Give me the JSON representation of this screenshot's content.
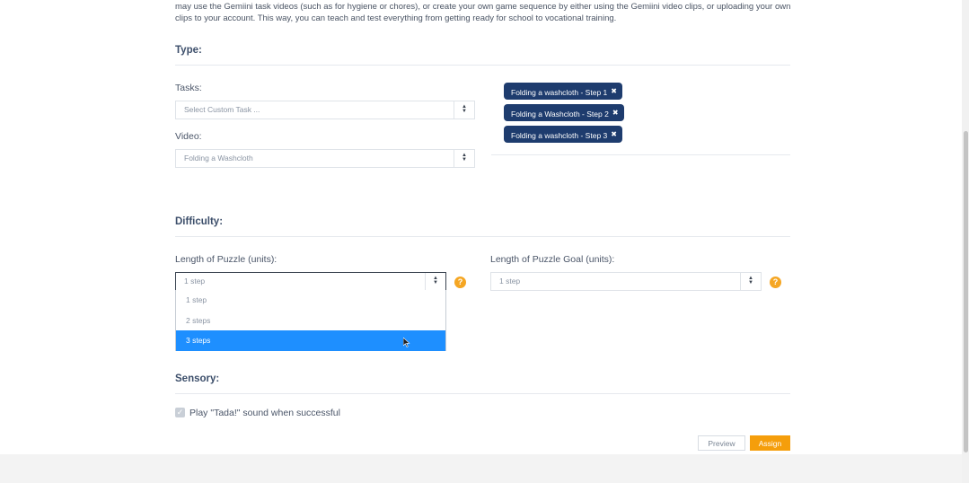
{
  "intro": {
    "text": "may use the Gemiini task videos (such as for hygiene or chores), or create your own game sequence by either using the Gemiini video clips, or uploading your own clips to your account. This way, you can teach and test everything from getting ready for school to vocational training."
  },
  "type_section": {
    "title": "Type:",
    "tasks_label": "Tasks:",
    "tasks_placeholder": "Select Custom Task ...",
    "video_label": "Video:",
    "video_value": "Folding a Washcloth",
    "selected_tags": [
      "Folding a washcloth - Step 1",
      "Folding a Washcloth - Step 2",
      "Folding a washcloth - Step 3"
    ]
  },
  "difficulty": {
    "title": "Difficulty:",
    "length_label": "Length of Puzzle (units):",
    "length_value": "1 step",
    "options": [
      "1 step",
      "2 steps",
      "3 steps"
    ],
    "highlighted_option": "3 steps",
    "goal_label": "Length of Puzzle Goal (units):",
    "goal_value": "1 step",
    "help_glyph": "?"
  },
  "sensory": {
    "title": "Sensory:",
    "tada_label": "Play \"Tada!\" sound when successful",
    "tada_checked": true
  },
  "actions": {
    "preview_label": "Preview",
    "assign_label": "Assign"
  },
  "colors": {
    "tag_bg": "#1e3c6e",
    "highlight": "#1e8fff",
    "assign": "#f59e0b",
    "help": "#f5a623"
  }
}
